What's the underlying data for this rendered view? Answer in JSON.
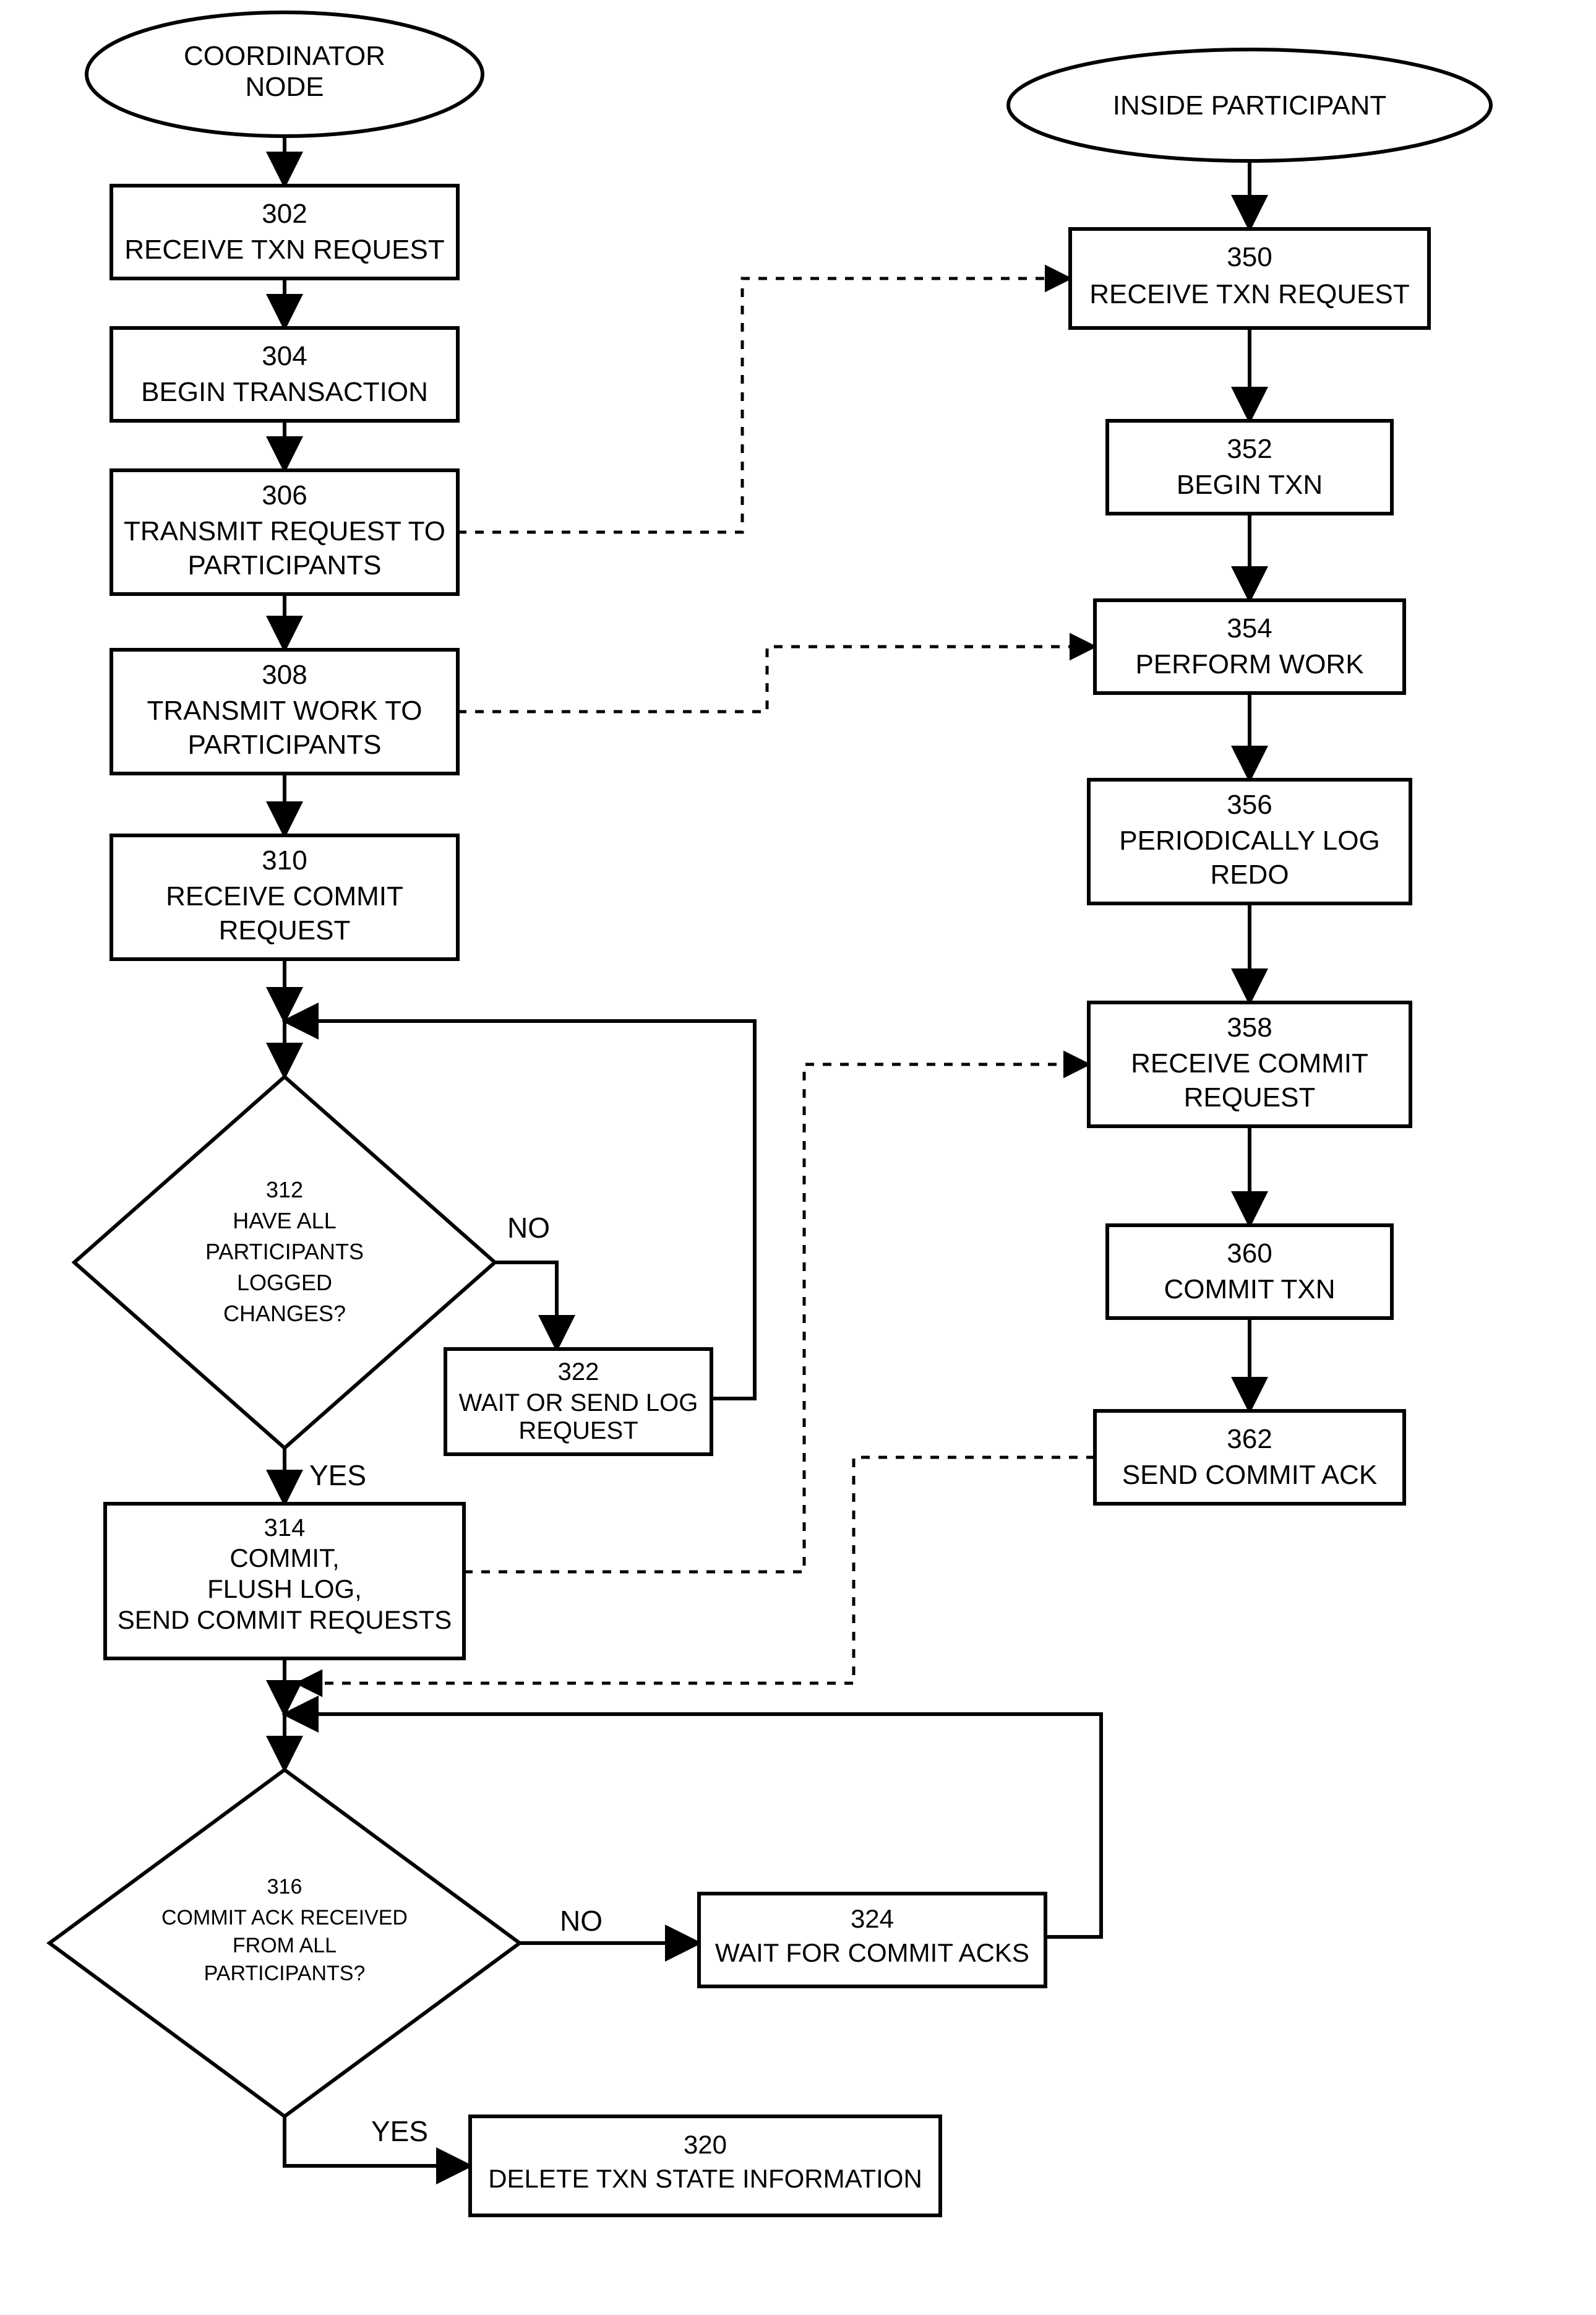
{
  "left_title": "COORDINATOR NODE",
  "right_title": "INSIDE PARTICIPANT",
  "n302": {
    "num": "302",
    "t1": "RECEIVE TXN REQUEST"
  },
  "n304": {
    "num": "304",
    "t1": "BEGIN TRANSACTION"
  },
  "n306": {
    "num": "306",
    "t1": "TRANSMIT REQUEST TO",
    "t2": "PARTICIPANTS"
  },
  "n308": {
    "num": "308",
    "t1": "TRANSMIT WORK TO",
    "t2": "PARTICIPANTS"
  },
  "n310": {
    "num": "310",
    "t1": "RECEIVE COMMIT",
    "t2": "REQUEST"
  },
  "n312": {
    "num": "312",
    "t1": "HAVE ALL",
    "t2": "PARTICIPANTS",
    "t3": "LOGGED",
    "t4": "CHANGES?"
  },
  "n322": {
    "num": "322",
    "t1": "WAIT OR SEND LOG",
    "t2": "REQUEST"
  },
  "n314": {
    "num": "314",
    "t1": "COMMIT,",
    "t2": "FLUSH LOG,",
    "t3": "SEND COMMIT REQUESTS"
  },
  "n316": {
    "num": "316",
    "t1": "COMMIT ACK RECEIVED",
    "t2": "FROM ALL",
    "t3": "PARTICIPANTS?"
  },
  "n324": {
    "num": "324",
    "t1": "WAIT FOR COMMIT ACKS"
  },
  "n320": {
    "num": "320",
    "t1": "DELETE TXN STATE INFORMATION"
  },
  "n350": {
    "num": "350",
    "t1": "RECEIVE TXN REQUEST"
  },
  "n352": {
    "num": "352",
    "t1": "BEGIN TXN"
  },
  "n354": {
    "num": "354",
    "t1": "PERFORM WORK"
  },
  "n356": {
    "num": "356",
    "t1": "PERIODICALLY LOG",
    "t2": "REDO"
  },
  "n358": {
    "num": "358",
    "t1": "RECEIVE COMMIT",
    "t2": "REQUEST"
  },
  "n360": {
    "num": "360",
    "t1": "COMMIT TXN"
  },
  "n362": {
    "num": "362",
    "t1": "SEND COMMIT ACK"
  },
  "labels": {
    "yes": "YES",
    "no": "NO"
  }
}
